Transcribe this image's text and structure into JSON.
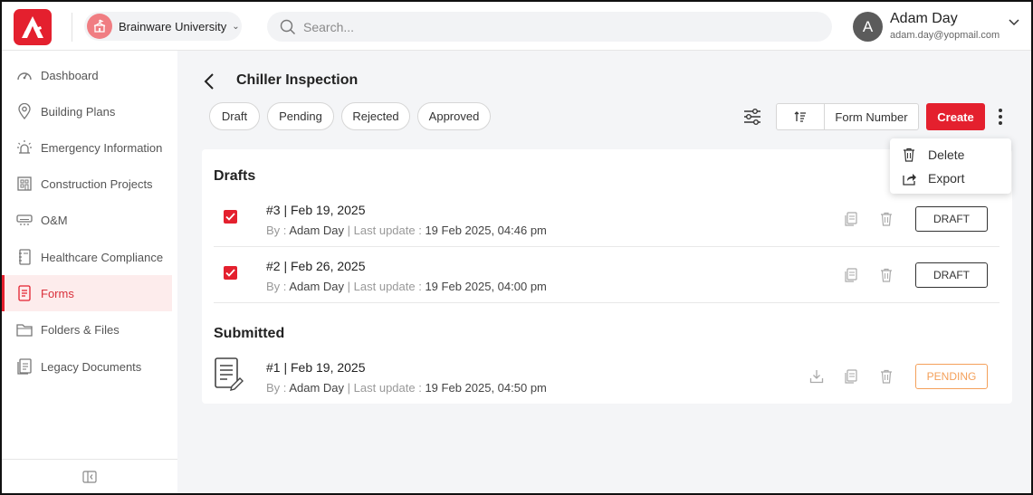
{
  "header": {
    "org_name": "Brainware University",
    "search_placeholder": "Search...",
    "user": {
      "initial": "A",
      "name": "Adam Day",
      "email": "adam.day@yopmail.com"
    }
  },
  "sidebar": {
    "items": [
      {
        "label": "Dashboard",
        "icon": "dashboard-icon",
        "active": false
      },
      {
        "label": "Building Plans",
        "icon": "map-pin-icon",
        "active": false
      },
      {
        "label": "Emergency Information",
        "icon": "alarm-icon",
        "active": false
      },
      {
        "label": "Construction Projects",
        "icon": "building-icon",
        "active": false
      },
      {
        "label": "O&M",
        "icon": "ac-unit-icon",
        "active": false
      },
      {
        "label": "Healthcare Compliance",
        "icon": "notebook-icon",
        "active": false
      },
      {
        "label": "Forms",
        "icon": "forms-icon",
        "active": true
      },
      {
        "label": "Folders & Files",
        "icon": "folder-icon",
        "active": false
      },
      {
        "label": "Legacy Documents",
        "icon": "documents-icon",
        "active": false
      }
    ]
  },
  "page": {
    "title": "Chiller Inspection",
    "filters": [
      "Draft",
      "Pending",
      "Rejected",
      "Approved"
    ],
    "sort_label": "Form Number",
    "create_label": "Create"
  },
  "menu": {
    "delete_label": "Delete",
    "export_label": "Export"
  },
  "drafts": {
    "title": "Drafts",
    "rows": [
      {
        "title": "#3 | Feb 19, 2025",
        "by_label": "By :",
        "by": "Adam Day",
        "updated_label": "Last update :",
        "updated": "19 Feb 2025, 04:46 pm",
        "status": "DRAFT"
      },
      {
        "title": "#2 | Feb 26, 2025",
        "by_label": "By :",
        "by": "Adam Day",
        "updated_label": "Last update :",
        "updated": "19 Feb 2025, 04:00 pm",
        "status": "DRAFT"
      }
    ]
  },
  "submitted": {
    "title": "Submitted",
    "rows": [
      {
        "title": "#1 | Feb 19, 2025",
        "by_label": "By :",
        "by": "Adam Day",
        "updated_label": "Last update :",
        "updated": "19 Feb 2025, 04:50 pm",
        "status": "PENDING"
      }
    ]
  },
  "colors": {
    "accent": "#e4202e",
    "pending": "#f4a05a"
  }
}
